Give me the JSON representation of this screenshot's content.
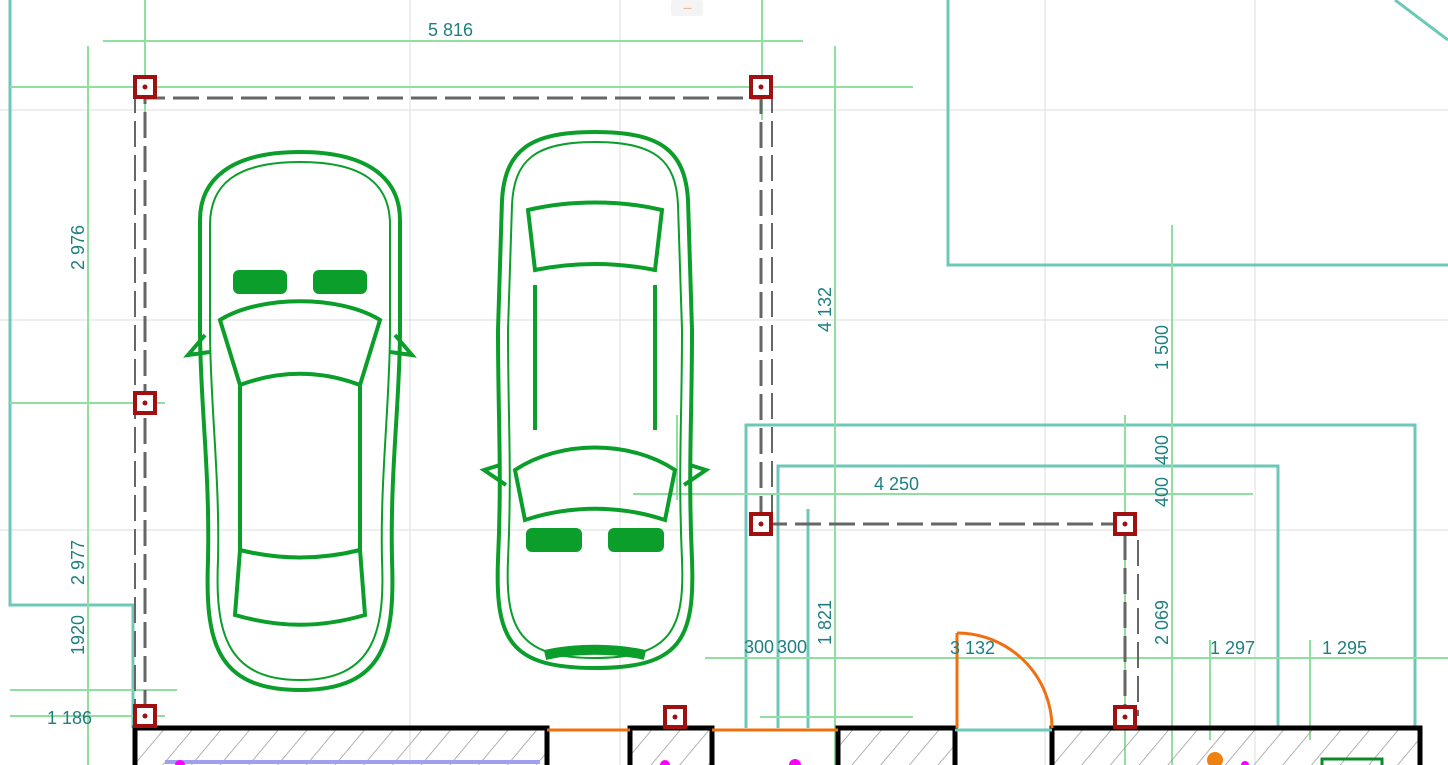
{
  "toolbar": {
    "handle_label": "----"
  },
  "colors": {
    "car": "#0b9e2a",
    "dimension_text": "#1f7f80",
    "guide": "#90dea0",
    "outline": "#6cc9b8",
    "column": "#a01010",
    "door": "#f07010",
    "wall": "#000000"
  },
  "dimensions": [
    {
      "text": "5 816"
    },
    {
      "text": "2 976"
    },
    {
      "text": "2 977"
    },
    {
      "text": "1920"
    },
    {
      "text": "1 186"
    },
    {
      "text": "4 132"
    },
    {
      "text": "1 500"
    },
    {
      "text": "400"
    },
    {
      "text": "400"
    },
    {
      "text": "4 250"
    },
    {
      "text": "300"
    },
    {
      "text": "300"
    },
    {
      "text": "1 821"
    },
    {
      "text": "3 132"
    },
    {
      "text": "2 069"
    },
    {
      "text": "1 297"
    },
    {
      "text": "1 295"
    }
  ],
  "objects": [
    {
      "type": "car",
      "icon": "car-top-view-icon"
    },
    {
      "type": "car",
      "icon": "car-top-view-icon"
    },
    {
      "type": "door",
      "icon": "door-swing-icon"
    }
  ]
}
